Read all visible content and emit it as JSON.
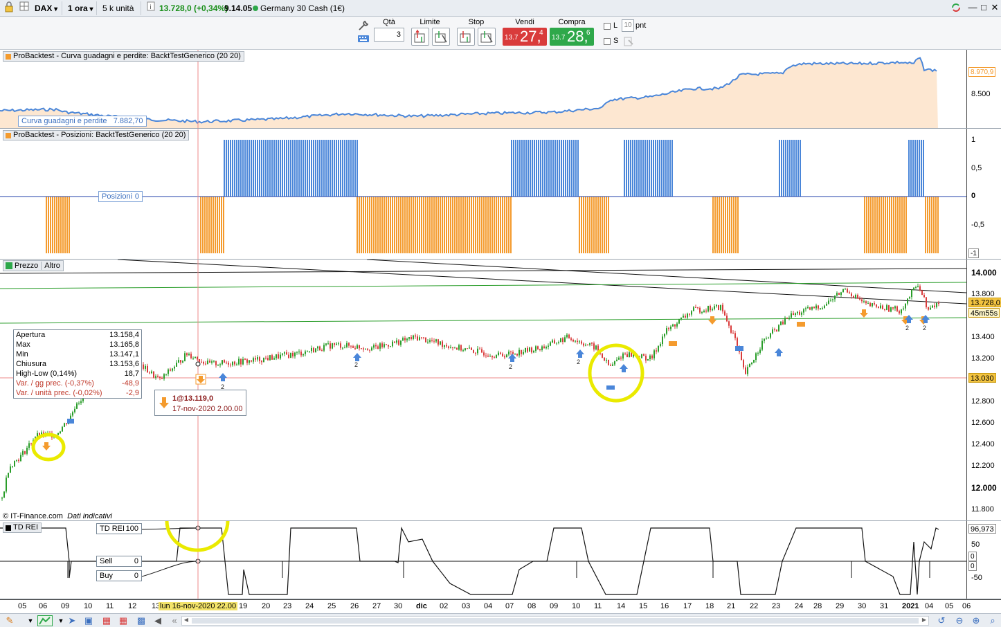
{
  "toolbar": {
    "instrument": "DAX",
    "timeframe": "1 ora",
    "units": "5 k unità",
    "last_price": "13.728,0 (+0,34%)",
    "time": "9.14.05",
    "instrument_name": "Germany 30 Cash (1€)",
    "colors": {
      "up": "#1a8f1a",
      "sell": "#d93b3b",
      "buy": "#2ea84a"
    }
  },
  "order": {
    "qty_label": "Qtà",
    "qty_value": "3",
    "limit_label": "Limite",
    "stop_label": "Stop",
    "sell_label": "Vendi",
    "buy_label": "Compra",
    "sell_small": "13.7",
    "sell_big": "27,",
    "sell_sup": "4",
    "buy_small": "13.7",
    "buy_big": "28,",
    "buy_sup": "6",
    "l_label": "L",
    "pnt_value": "10",
    "pnt_label": "pnt",
    "s_label": "S"
  },
  "equity_panel": {
    "title": "ProBacktest - Curva guadagni e perdite: BacktTestGenerico (20 20)",
    "series_label": "Curva guadagni e perdite",
    "series_value": "7.882,70",
    "axis": [
      "8.970,9",
      "8.500"
    ],
    "colors": {
      "fill": "#fde7d1",
      "line": "#4a86d9"
    }
  },
  "positions_panel": {
    "title": "ProBacktest - Posizioni: BacktTestGenerico (20 20)",
    "series_label": "Posizioni",
    "series_value": "0",
    "axis": [
      "1",
      "0,5",
      "0",
      "-0,5",
      "-1"
    ],
    "colors": {
      "long": "#4a86d9",
      "short": "#f49b2e"
    }
  },
  "price_panel": {
    "tabs": [
      "Prezzo",
      "Altro"
    ],
    "axis": [
      "14.000",
      "13.800",
      "13.600",
      "13.400",
      "13.200",
      "12.800",
      "12.600",
      "12.400",
      "12.200",
      "12.000",
      "11.800"
    ],
    "current_price": "13.728,0",
    "countdown": "45m55s",
    "cursor_price": "13.030",
    "source": "© IT-Finance.com",
    "source_note": "Dati indicativi",
    "markers": [
      "2",
      "2",
      "2",
      "2",
      "2",
      "2",
      "2"
    ],
    "info": [
      {
        "label": "Apertura",
        "value": "13.158,4"
      },
      {
        "label": "Max",
        "value": "13.165,8"
      },
      {
        "label": "Min",
        "value": "13.147,1"
      },
      {
        "label": "Chiusura",
        "value": "13.153,6"
      },
      {
        "label": "High-Low (0,14%)",
        "value": "18,7"
      },
      {
        "label": "Var. / gg prec. (-0,37%)",
        "value": "-48,9"
      },
      {
        "label": "Var. / unità prec. (-0,02%)",
        "value": "-2,9"
      }
    ],
    "trade": {
      "title": "1@13.119,0",
      "date": "17-nov-2020 2.00.00"
    }
  },
  "tdrei_panel": {
    "title": "TD REI",
    "label": "TD REI",
    "value": "100",
    "sell_label": "Sell",
    "sell_value": "0",
    "buy_label": "Buy",
    "buy_value": "0",
    "axis": [
      "96,973",
      "50",
      "0",
      "0",
      "-50"
    ]
  },
  "xaxis": {
    "labels": [
      "05",
      "06",
      "09",
      "10",
      "11",
      "12",
      "13",
      "lun 16-nov-2020 22.00",
      "19",
      "20",
      "23",
      "24",
      "25",
      "26",
      "27",
      "30",
      "dic",
      "02",
      "03",
      "04",
      "07",
      "08",
      "09",
      "10",
      "11",
      "14",
      "15",
      "16",
      "17",
      "18",
      "21",
      "22",
      "23",
      "24",
      "28",
      "29",
      "30",
      "31",
      "2021",
      "04",
      "05",
      "06"
    ]
  }
}
